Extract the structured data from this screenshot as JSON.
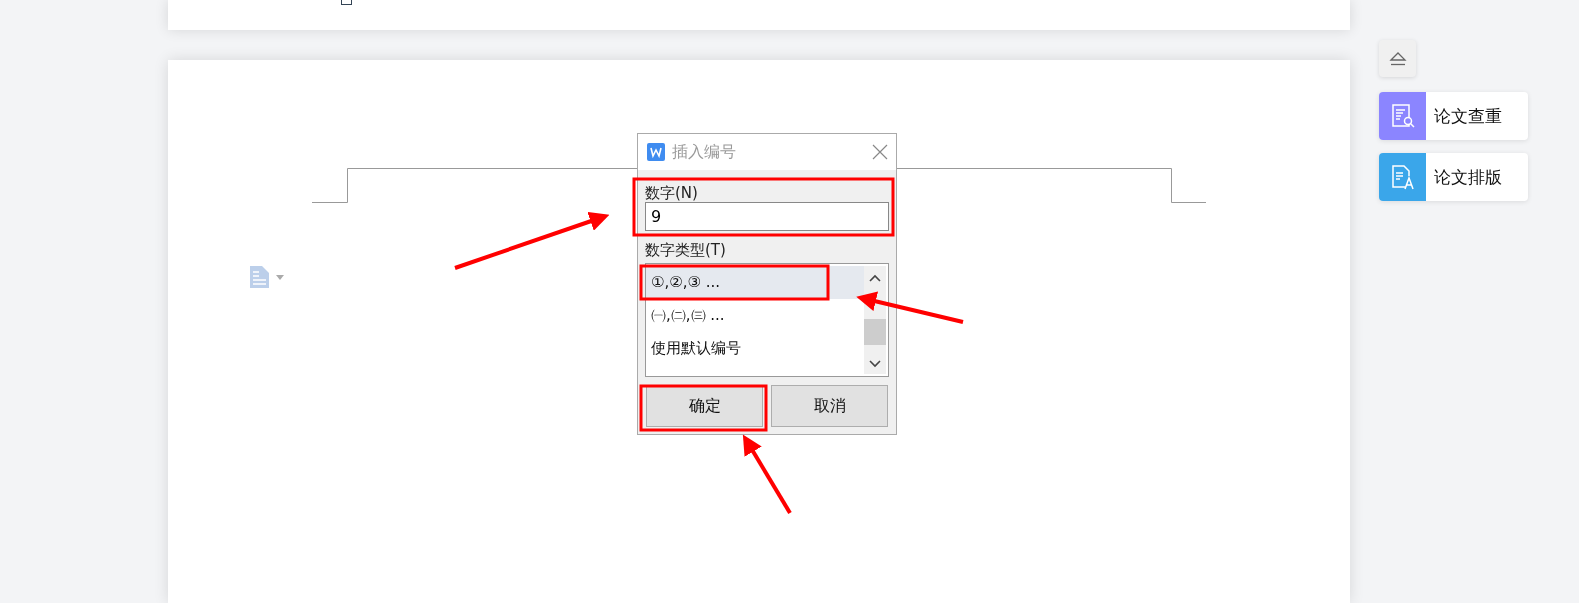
{
  "dialog": {
    "title": "插入编号",
    "number_label": "数字(N)",
    "number_value": "9",
    "type_label": "数字类型(T)",
    "types": [
      {
        "label": "①,②,③ ...",
        "selected": true
      },
      {
        "label": "㈠,㈡,㈢ ...",
        "selected": false
      },
      {
        "label": "使用默认编号",
        "selected": false
      }
    ],
    "buttons": [
      "确定",
      "取消"
    ]
  },
  "side_tools": [
    {
      "label": "论文查重",
      "color": "#8b85ff",
      "kind": "check"
    },
    {
      "label": "论文排版",
      "color": "#3aa6ea",
      "kind": "format"
    }
  ]
}
